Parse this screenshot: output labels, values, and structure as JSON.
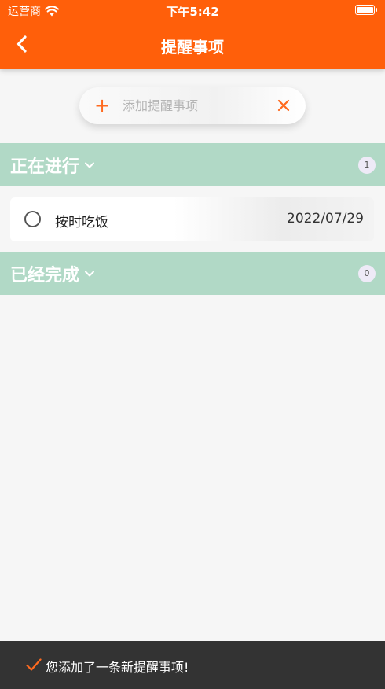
{
  "status_bar": {
    "carrier": "运营商",
    "time": "下午5:42",
    "icons": [
      "wifi-icon",
      "battery-icon"
    ]
  },
  "nav": {
    "title": "提醒事项",
    "back_icon": "chevron-left-icon"
  },
  "add_bar": {
    "placeholder": "添加提醒事项",
    "value": "",
    "add_icon": "plus-icon",
    "clear_icon": "close-icon"
  },
  "sections": {
    "in_progress": {
      "title": "正在进行",
      "count": "1",
      "tasks": [
        {
          "text": "按时吃饭",
          "date": "2022/07/29",
          "done": false
        }
      ]
    },
    "completed": {
      "title": "已经完成",
      "count": "0",
      "tasks": []
    }
  },
  "toast": {
    "message": "您添加了一条新提醒事项!",
    "icon": "checkmark-icon"
  },
  "colors": {
    "accent": "#ff5f0a",
    "section_bg": "#b1d9c6",
    "page_bg": "#f6f6f6",
    "toast_bg": "#333333"
  }
}
